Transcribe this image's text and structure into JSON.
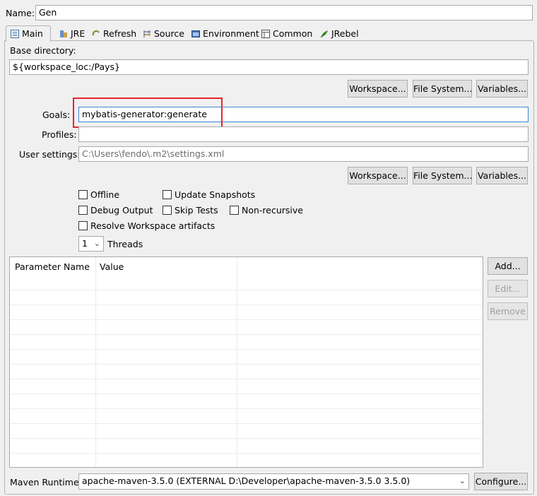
{
  "name_field": {
    "label": "Name:",
    "value": "Gen"
  },
  "tabs": [
    {
      "label": "Main",
      "icon": "main-tab-icon"
    },
    {
      "label": "JRE",
      "icon": "jre-icon"
    },
    {
      "label": "Refresh",
      "icon": "refresh-icon"
    },
    {
      "label": "Source",
      "icon": "source-icon"
    },
    {
      "label": "Environment",
      "icon": "environment-icon"
    },
    {
      "label": "Common",
      "icon": "common-icon"
    },
    {
      "label": "JRebel",
      "icon": "jrebel-icon"
    }
  ],
  "base_directory": {
    "label": "Base directory:",
    "value": "${workspace_loc:/Pays}",
    "buttons": {
      "workspace": "Workspace...",
      "file_system": "File System...",
      "variables": "Variables..."
    }
  },
  "goals": {
    "label": "Goals:",
    "value": "mybatis-generator:generate"
  },
  "profiles": {
    "label": "Profiles:",
    "value": ""
  },
  "user_settings": {
    "label": "User settings:",
    "value": "C:\\Users\\fendo\\.m2\\settings.xml",
    "buttons": {
      "workspace": "Workspace...",
      "file_system": "File System...",
      "variables": "Variables..."
    }
  },
  "options": {
    "offline": "Offline",
    "update_snapshots": "Update Snapshots",
    "debug_output": "Debug Output",
    "skip_tests": "Skip Tests",
    "non_recursive": "Non-recursive",
    "resolve_workspace": "Resolve Workspace artifacts",
    "threads_value": "1",
    "threads_label": "Threads"
  },
  "parameters": {
    "columns": [
      "Parameter Name",
      "Value"
    ],
    "buttons": {
      "add": "Add...",
      "edit": "Edit...",
      "remove": "Remove"
    }
  },
  "maven_runtime": {
    "label": "Maven Runtime:",
    "value": "apache-maven-3.5.0 (EXTERNAL D:\\Developer\\apache-maven-3.5.0 3.5.0)",
    "configure": "Configure..."
  }
}
